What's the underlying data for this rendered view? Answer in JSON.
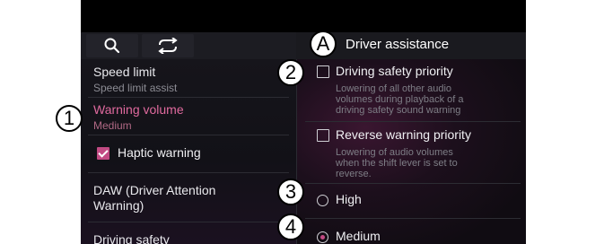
{
  "panel_title": "Driver assistance",
  "toolbar": {
    "search_icon": "search-icon",
    "swap_icon": "swap-arrows-icon"
  },
  "menu": {
    "speed_limit": {
      "label": "Speed limit",
      "sub": "Speed limit assist"
    },
    "warning_volume": {
      "label": "Warning volume",
      "sub": "Medium"
    },
    "haptic_warning": {
      "label": "Haptic warning",
      "checked": true
    },
    "daw": {
      "label_line1": "DAW (Driver Attention",
      "label_line2": "Warning)"
    },
    "driving_safety": {
      "label": "Driving safety"
    }
  },
  "options": {
    "driving_safety_priority": {
      "label": "Driving safety priority",
      "desc_line1": "Lowering of all other audio",
      "desc_line2": "volumes during playback of a",
      "desc_line3": "driving safety sound warning",
      "checked": false
    },
    "reverse_warning_priority": {
      "label": "Reverse warning priority",
      "desc_line1": "Lowering of audio volumes",
      "desc_line2": "when the shift lever is set to",
      "desc_line3": "reverse.",
      "checked": false
    },
    "volume_levels": [
      {
        "label": "High",
        "selected": false
      },
      {
        "label": "Medium",
        "selected": true
      }
    ]
  },
  "callouts": {
    "a": "A",
    "one": "1",
    "two": "2",
    "three": "3",
    "four": "4"
  },
  "colors": {
    "accent": "#c24a83",
    "active_text": "#e06a9e"
  }
}
